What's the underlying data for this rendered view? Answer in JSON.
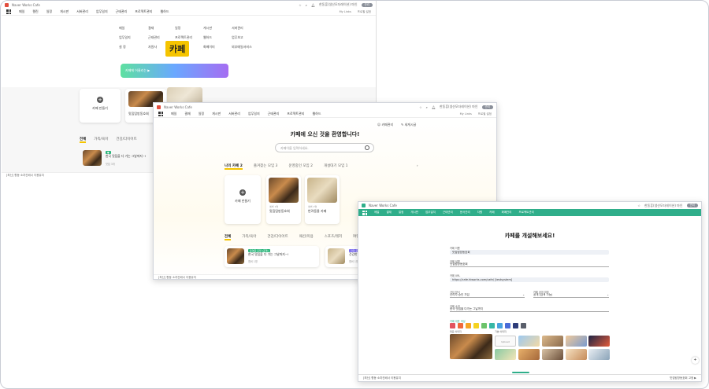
{
  "window1": {
    "title": "Naver Works Cafe",
    "user": "한동훈(생산모더레이션) 마인",
    "pill": "관리",
    "nav": [
      "메일",
      "캘린",
      "일정",
      "게시판",
      "서버관리",
      "업무일지",
      "근태관리",
      "프로젝트관리",
      "웹하드"
    ],
    "nav_right": [
      "My Links",
      "프로필 설정"
    ],
    "mega_menu": [
      [
        "메일",
        "결재",
        "일정",
        "게시판",
        "서버관리"
      ],
      [
        "업무일지",
        "근태관리",
        "프로젝트관리",
        "웹하드",
        "업무보고"
      ],
      [
        "설 정",
        "자원사",
        "카페",
        "화폐이미",
        "외부메일서비스"
      ]
    ],
    "highlight": "카페",
    "banner_text": "카페에 어울리는 ▶",
    "create_card": "카페 만들기",
    "card_title": "맛집탐방동호회",
    "tabs": [
      "전체",
      "가족/육아",
      "건강/다이어트"
    ],
    "list_title": "한국 맛집을 다 가는 그날까지~!",
    "list_meta": "맛집 3개",
    "footer": "[최신] 향동 소치킨배너 이용유지"
  },
  "window2": {
    "title": "Naver Works Cafe",
    "user": "한동훈(생산모더레이션) 마인",
    "pill": "관리",
    "nav": [
      "메일",
      "결재",
      "일정",
      "게시판",
      "서버관리",
      "업무일지",
      "근태관리",
      "프로젝트관리",
      "웹하드"
    ],
    "nav_right": [
      "My Links",
      "프로필 설정"
    ],
    "top_links": [
      "카페관리",
      "새게시글"
    ],
    "welcome": "카페에 오신 것을 환영합니다!",
    "search_placeholder": "카페이름 입력하세요.",
    "cafe_tabs": [
      "나의 카페 2",
      "즐겨찾는 모임 3",
      "운영중인 모임 2",
      "개설대기 모임 1"
    ],
    "create_card": "카페 만들기",
    "cards": [
      {
        "meta": "멤버 1명",
        "title": "맛집탐방동호회"
      },
      {
        "meta": "멤버 1명",
        "title": "반려동물 카페"
      }
    ],
    "category_tabs": [
      "전체",
      "가족/육아",
      "건강/다이어트",
      "패션/미용",
      "스포츠/레저",
      "여행"
    ],
    "list": [
      {
        "badge": "운영중 모임 (공개)",
        "title": "한국 맛집을 다 가는 그날까지~!",
        "meta": "멤버 1명"
      },
      {
        "badge": "건강 모임",
        "title": "건강한 반려생활",
        "meta": "멤버 1명"
      }
    ],
    "footer": "[최신] 향동 소치킨배너 이용유지"
  },
  "window3": {
    "title": "Naver Works Cafe",
    "user": "한동훈(생산모더레이션) 마인",
    "pill": "관리",
    "nav": [
      "메일",
      "결재",
      "일정",
      "게시판",
      "업무일지",
      "근태관리",
      "문서관리",
      "자원",
      "카페",
      "화폐관리",
      "프로젝트관리"
    ],
    "heading": "카페를 개설해보세요!",
    "fields": [
      {
        "label": "카페 이름",
        "value": "맛집탐방동호회"
      },
      {
        "label": "카페 설명",
        "value": "맛집탐방동호회"
      },
      {
        "label": "카페 URL",
        "value": "https://cafe.hiworks.com/cafe/ [testsystem]"
      }
    ],
    "join_label": "가입 방식",
    "join_value": "관리자 승인 가입",
    "visibility_label": "카페 공개 여부",
    "visibility_value": "공개 (검색 가능)",
    "intro_label": "카페 소개",
    "intro_value": "한국 맛집을 다가는 그날까지",
    "color_label": "카페 대표 색상",
    "colors": [
      "#e2555f",
      "#ef6b3b",
      "#f5a623",
      "#f5d320",
      "#6cc36b",
      "#37b8a6",
      "#4aa3df",
      "#4a6cd8",
      "#2e3d7a",
      "#5a5f6b"
    ],
    "image_label": "대표 이미지",
    "preset_label": "기본 이미지",
    "upload_label": "Upload",
    "footer": "[최신] 향동 소치킨배너 이용유지",
    "footer_right": "맛집탐방동호회 고정 ▶"
  }
}
